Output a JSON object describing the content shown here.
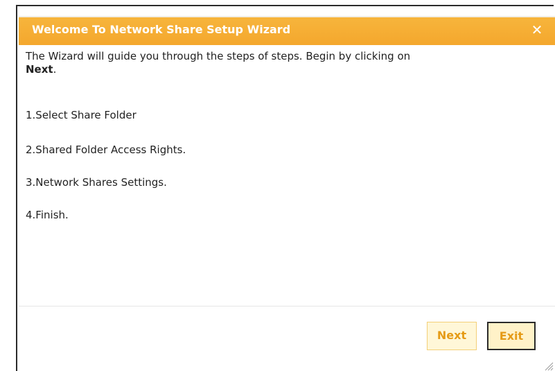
{
  "dialog": {
    "title": "Welcome To Network Share Setup Wizard",
    "close_icon": "close-icon",
    "intro_text": "The Wizard will guide you through the steps of steps. Begin by clicking on",
    "intro_bold": "Next",
    "intro_end": ".",
    "steps": [
      "1.Select Share Folder",
      "2.Shared Folder Access Rights.",
      "3.Network Shares Settings.",
      "4.Finish."
    ],
    "buttons": {
      "next_label": "Next",
      "exit_label": "Exit"
    }
  },
  "colors": {
    "title_bar": "#f4a72d",
    "button_text": "#e59b17",
    "button_bg": "#fff7d8"
  }
}
